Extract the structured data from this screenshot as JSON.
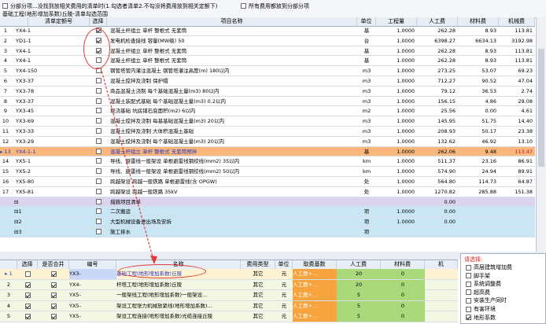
{
  "toolbar": {
    "opt1": "分部分项...没找到放相关费用的清单时(1.勾选者清单2.不勾没将费用放到相关定额下)",
    "opt2": "所有费用都放到分部分项",
    "breadcrumb": "基础工程(地形增加系数)丘陵-清单勾选范围"
  },
  "grid1": {
    "headers": [
      "清单定额号",
      "选择",
      "项目名称",
      "单位",
      "工程量",
      "人工费",
      "材料费",
      "机械费"
    ],
    "rows": [
      {
        "num": "1",
        "code": "YX4-1",
        "checked": true,
        "name": "混凝土杆组立 单杆 整根式 无套筒",
        "unit": "基",
        "qty": "1.0000",
        "labor": "262.28",
        "mat": "8.93",
        "mach": "113.81",
        "style": ""
      },
      {
        "num": "2",
        "code": "YD1-1",
        "checked": true,
        "name": "发电机检查接线 容量(MW级) 50",
        "unit": "台",
        "qty": "1.0000",
        "labor": "6398.27",
        "mat": "6634.13",
        "mach": "3192.98",
        "style": ""
      },
      {
        "num": "3",
        "code": "YX4-1",
        "checked": true,
        "name": "混凝土杆组立 单杆 整根式 无套筒",
        "unit": "基",
        "qty": "1.0000",
        "labor": "262.28",
        "mat": "8.93",
        "mach": "113.81",
        "style": ""
      },
      {
        "num": "4",
        "code": "YX4-1",
        "checked": false,
        "name": "混凝土杆组立 单杆 整根式 无套筒",
        "unit": "基",
        "qty": "1.0000",
        "labor": "262.28",
        "mat": "8.93",
        "mach": "113.81",
        "style": ""
      },
      {
        "num": "5",
        "code": "YX4-150",
        "checked": false,
        "name": "钢管塔管内灌注混凝土 钢管塔灌注高度(m) 180以内",
        "unit": "m3",
        "qty": "1.0000",
        "labor": "273.25",
        "mat": "53.07",
        "mach": "69.23",
        "style": ""
      },
      {
        "num": "6",
        "code": "YX3-37",
        "checked": false,
        "name": "混凝土搅拌及浇制 保护帽",
        "unit": "m3",
        "qty": "1.0000",
        "labor": "712.27",
        "mat": "90.52",
        "mach": "47.04",
        "style": ""
      },
      {
        "num": "7",
        "code": "YX3-78",
        "checked": false,
        "name": "商品混凝土浇制 每个基础混凝土量(m3) 80以内",
        "unit": "m3",
        "qty": "1.0000",
        "labor": "79.12",
        "mat": "36.53",
        "mach": "2.74",
        "style": ""
      },
      {
        "num": "8",
        "code": "YX3-37",
        "checked": false,
        "name": "混凝土装配式基础 每个基础混凝土量(m3) 0.2以内",
        "unit": "m3",
        "qty": "1.0000",
        "labor": "156.15",
        "mat": "4.86",
        "mach": "29.08",
        "style": ""
      },
      {
        "num": "9",
        "code": "YX3-45",
        "checked": false,
        "name": "现浇基础 坑底铺石底面积(m2) 6以内",
        "unit": "m2",
        "qty": "1.0000",
        "labor": "25.56",
        "mat": "0.00",
        "mach": "4.61",
        "style": ""
      },
      {
        "num": "10",
        "code": "YX3-69",
        "checked": false,
        "name": "混凝土搅拌及浇制 每基基础混凝土量(m3) 20以内",
        "unit": "m3",
        "qty": "1.0000",
        "labor": "145.95",
        "mat": "51.75",
        "mach": "14.40",
        "style": ""
      },
      {
        "num": "11",
        "code": "YX3-33",
        "checked": false,
        "name": "混凝土搅拌及浇制 大体积混凝土基础",
        "unit": "m3",
        "qty": "1.0000",
        "labor": "208.93",
        "mat": "50.17",
        "mach": "23.38",
        "style": ""
      },
      {
        "num": "12",
        "code": "YX3-29",
        "checked": false,
        "name": "混凝土搅拌及浇制 每个基础混凝土量(m3) 20以内",
        "unit": "m3",
        "qty": "1.0000",
        "labor": "132.62",
        "mat": "46.92",
        "mach": "13.10",
        "style": ""
      },
      {
        "num": "13",
        "code": "YX4-1-1",
        "checked": false,
        "name": "混凝土杆组立 单杆 整根式 无套筒预拌",
        "unit": "基",
        "qty": "1.0000",
        "labor": "262.06",
        "mat": "9.48",
        "mach": "113.47",
        "style": "sel"
      },
      {
        "num": "14",
        "code": "YX5-1",
        "checked": false,
        "name": "导线、避雷线一般架设 单根避雷线钢绞线(mm2) 35以内",
        "unit": "km",
        "qty": "1.0000",
        "labor": "511.37",
        "mat": "23.16",
        "mach": "86.91",
        "style": ""
      },
      {
        "num": "15",
        "code": "YX5-2",
        "checked": false,
        "name": "导线、避雷线一般架设 单根避雷线钢绞线(mm2) 50以内",
        "unit": "km",
        "qty": "1.0000",
        "labor": "574.90",
        "mat": "24.94",
        "mach": "89.91",
        "style": ""
      },
      {
        "num": "16",
        "code": "YX5-80",
        "checked": false,
        "name": "跨越架设 跨越一般铁路 单根避雷线(含 OPGW)",
        "unit": "处",
        "qty": "1.0000",
        "labor": "564.80",
        "mat": "114.73",
        "mach": "64.87",
        "style": ""
      },
      {
        "num": "17",
        "code": "YX5-81",
        "checked": false,
        "name": "跨越架设 跨越一般铁路 35kV",
        "unit": "处",
        "qty": "1.0000",
        "labor": "1270.82",
        "mat": "285.88",
        "mach": "151.38",
        "style": ""
      },
      {
        "num": "",
        "code": "⊟",
        "checked": false,
        "name": "措施项目清单",
        "unit": "",
        "qty": "",
        "labor": "0.00",
        "mat": "",
        "mach": "",
        "style": "purple"
      },
      {
        "num": "",
        "code": "⊟1",
        "checked": false,
        "name": "二次搬运",
        "unit": "项",
        "qty": "1.0000",
        "labor": "0.00",
        "mat": "",
        "mach": "",
        "style": "blue"
      },
      {
        "num": "",
        "code": "⊟2",
        "checked": false,
        "name": "大型机械设备进出场及安拆",
        "unit": "项",
        "qty": "1.0000",
        "labor": "0.00",
        "mat": "",
        "mach": "",
        "style": "blue"
      },
      {
        "num": "",
        "code": "⊟3",
        "checked": false,
        "name": "施工排水",
        "unit": "项",
        "qty": "",
        "labor": "",
        "mat": "",
        "mach": "",
        "style": "blue"
      }
    ]
  },
  "grid2": {
    "headers": [
      "选择",
      "是否合并",
      "编号",
      "名称",
      "费用类型",
      "单位",
      "取费基数",
      "人工费",
      "材料费",
      "机"
    ],
    "rows": [
      {
        "num": "1",
        "sel": false,
        "merge": true,
        "code": "YX3-",
        "name": "基础工程(地形增加系数)丘陵",
        "type": "其它",
        "unit": "元",
        "base": "人工费+...",
        "labor": "20",
        "mat": "0",
        "style": "sel"
      },
      {
        "num": "2",
        "sel": true,
        "merge": true,
        "code": "YX4-",
        "name": "杆塔工程(地形增加系数)丘陵",
        "type": "其它",
        "unit": "元",
        "base": "人工费+...",
        "labor": "20",
        "mat": "0",
        "style": ""
      },
      {
        "num": "3",
        "sel": true,
        "merge": true,
        "code": "YX5-",
        "name": "一般架线工程(地形增加系数)一般架设...",
        "type": "其它",
        "unit": "元",
        "base": "人工费+...",
        "labor": "5",
        "mat": "0",
        "style": ""
      },
      {
        "num": "4",
        "sel": true,
        "merge": true,
        "code": "YX5-",
        "name": "架设工程张力机械放紧线(地形增加系数)...",
        "type": "其它",
        "unit": "元",
        "base": "人工费+...",
        "labor": "5",
        "mat": "0",
        "style": ""
      },
      {
        "num": "5",
        "sel": true,
        "merge": true,
        "code": "YX5-",
        "name": "架设工程连接(地形增加系数)光缆连接丘陵",
        "type": "其它",
        "unit": "元",
        "base": "人工费+...",
        "labor": "5",
        "mat": "0",
        "style": ""
      }
    ]
  },
  "rightpanel": {
    "title": "请选择:",
    "items": [
      {
        "label": "高层建筑增加费",
        "checked": false
      },
      {
        "label": "脚手架",
        "checked": false
      },
      {
        "label": "系统调整费",
        "checked": false
      },
      {
        "label": "超高费",
        "checked": false
      },
      {
        "label": "安装生产同时",
        "checked": false
      },
      {
        "label": "有害环境",
        "checked": false
      },
      {
        "label": "地形系数",
        "checked": true
      }
    ]
  }
}
